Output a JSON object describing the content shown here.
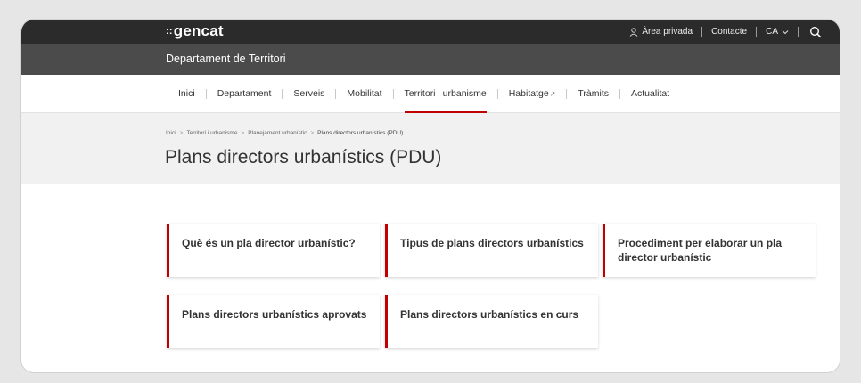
{
  "topbar": {
    "logo": "gencat",
    "logo_dots": "::",
    "private_area": "Àrea privada",
    "contact": "Contacte",
    "language": "CA",
    "search_icon": "search-icon",
    "user_icon": "user-icon"
  },
  "department": {
    "title": "Departament de Territori"
  },
  "nav": {
    "items": [
      {
        "label": "Inici"
      },
      {
        "label": "Departament"
      },
      {
        "label": "Serveis"
      },
      {
        "label": "Mobilitat"
      },
      {
        "label": "Territori i urbanisme"
      },
      {
        "label": "Habitatge"
      },
      {
        "label": "Tràmits"
      },
      {
        "label": "Actualitat"
      }
    ],
    "active_index": 4
  },
  "breadcrumb": {
    "items": [
      "Inici",
      "Territori i urbanisme",
      "Planejament urbanístic",
      "Plans directors urbanístics (PDU)"
    ]
  },
  "page": {
    "title": "Plans directors urbanístics (PDU)"
  },
  "cards": [
    {
      "label": "Què és un pla director urbanístic?"
    },
    {
      "label": "Tipus de plans directors urbanístics"
    },
    {
      "label": "Procediment per elaborar un pla director urbanístic"
    },
    {
      "label": "Plans directors urbanístics aprovats"
    },
    {
      "label": "Plans directors urbanístics en curs"
    }
  ],
  "colors": {
    "accent": "#c00000",
    "topbar": "#2b2b2b",
    "deptbar": "#4b4b4b",
    "band": "#f1f1f1"
  }
}
